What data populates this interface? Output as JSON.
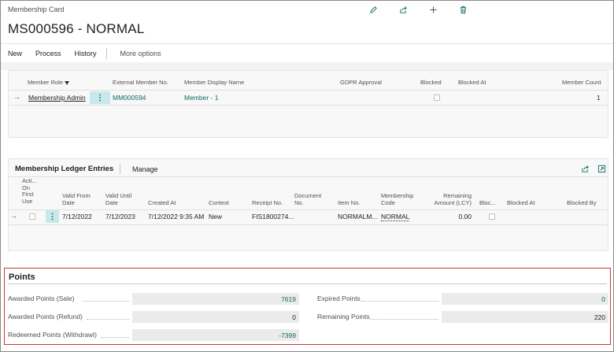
{
  "page": {
    "caption": "Membership Card",
    "title": "MS000596 - NORMAL",
    "icons": [
      "edit-icon",
      "share-icon",
      "add-icon",
      "delete-icon"
    ]
  },
  "actionbar": {
    "new": "New",
    "process": "Process",
    "history": "History",
    "more": "More options"
  },
  "roles_part": {
    "headers": {
      "role": "Member Role",
      "ext_no": "External Member No.",
      "display_name": "Member Display Name",
      "gdpr": "GDPR Approval",
      "blocked": "Blocked",
      "blocked_at": "Blocked At",
      "count": "Member Count"
    },
    "row": {
      "role": "Membership Admin",
      "ext_no": "MM000594",
      "display_name": "Member - 1",
      "count": "1"
    }
  },
  "ledger_part": {
    "title": "Membership Ledger Entries",
    "manage": "Manage",
    "headers": {
      "active": "Acti... On First Use",
      "valid_from": "Valid From Date",
      "valid_until": "Valid Until Date",
      "created_at": "Created At",
      "context": "Context",
      "receipt": "Receipt No.",
      "document": "Document No.",
      "item": "Item No.",
      "membership_code": "Membership Code",
      "remaining": "Remaining Amount (LCY)",
      "blocked": "Bloc...",
      "blocked_at": "Blocked At",
      "blocked_by": "Blocked By"
    },
    "row": {
      "valid_from": "7/12/2022",
      "valid_until": "7/12/2023",
      "created_at": "7/12/2022 9:35 AM",
      "context": "New",
      "receipt": "FIS1800274...",
      "item": "NORMALM...",
      "membership_code": "NORMAL",
      "remaining": "0.00"
    }
  },
  "points": {
    "title": "Points",
    "awarded_sale_label": "Awarded Points (Sale)",
    "awarded_sale": "7619",
    "awarded_refund_label": "Awarded Points (Refund)",
    "awarded_refund": "0",
    "redeemed_label": "Redeemed Points (Withdrawl)",
    "redeemed": "-7399",
    "expired_label": "Expired Points",
    "expired": "0",
    "remaining_label": "Remaining Points",
    "remaining": "220"
  },
  "colors": {
    "accent_link": "#0f6b66",
    "highlight_border": "#d0353b",
    "selected_kebab": "#c7e9ec"
  }
}
